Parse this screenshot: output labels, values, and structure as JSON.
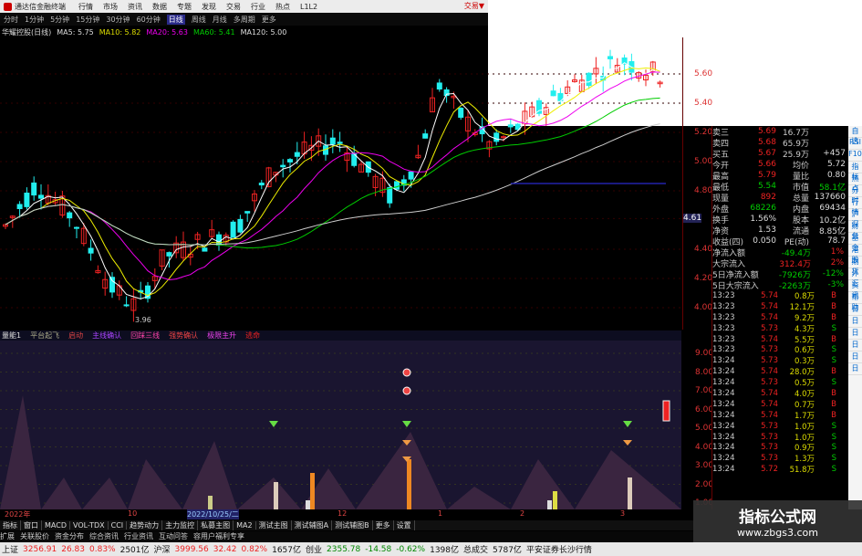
{
  "titlebar": {
    "app": "通达信金融终端",
    "trade": "交易▼"
  },
  "menu": [
    "行情",
    "市场",
    "资讯",
    "数据",
    "专题",
    "发现",
    "交易",
    "行业",
    "热点",
    "L1L2"
  ],
  "periods": [
    "分时",
    "1分钟",
    "5分钟",
    "15分钟",
    "30分钟",
    "60分钟",
    "日线",
    "周线",
    "月线",
    "多周期",
    "更多"
  ],
  "period_active": "日线",
  "ma": {
    "name": "华耀控股(日线)",
    "ma5": "MA5: 5.75",
    "ma10": "MA10: 5.82",
    "ma20": "MA20: 5.63",
    "ma60": "MA60: 5.41",
    "ma120": "MA120: 5.00"
  },
  "price_axis": [
    "5.60",
    "5.40",
    "5.20",
    "5.00",
    "4.80",
    "4.61",
    "4.40",
    "4.20",
    "4.00"
  ],
  "low_label": "3.96",
  "sub_indicator": {
    "name": "量能1",
    "items": [
      "平台起飞",
      "启动",
      "主线确认",
      "回踩三线",
      "强势确认",
      "极限主升",
      "逃命"
    ]
  },
  "sub_axis": [
    "9.00",
    "8.00",
    "7.00",
    "6.00",
    "5.00",
    "4.00",
    "3.00",
    "2.00",
    "1.00"
  ],
  "dates": [
    "2022年",
    "10",
    "2022/10/25/二",
    "12",
    "1",
    "2",
    "3"
  ],
  "tabs": [
    "指标",
    "窗口",
    "MACD",
    "VOL-TDX",
    "CCI",
    "趋势动力",
    "主力监控",
    "私募主图",
    "MA2",
    "测试主图",
    "测试辅图A",
    "测试辅图B",
    "更多",
    "设置"
  ],
  "toolbar2": [
    "扩展",
    "关联股价",
    "资金分布",
    "综合资讯",
    "行业资讯",
    "互动问答",
    "容用户福利专享"
  ],
  "status": {
    "sh_name": "上证",
    "sh": "3256.91",
    "sh_chg": "26.83",
    "sh_pct": "0.83%",
    "sh_amt": "2501亿",
    "sz_name": "沪深",
    "sz": "3999.56",
    "sz_chg": "32.42",
    "sz_pct": "0.82%",
    "sz_amt": "1657亿",
    "cy_name": "创业",
    "cy": "2355.78",
    "cy_chg": "-14.58",
    "cy_pct": "-0.62%",
    "cy_amt": "1398亿",
    "total_label": "总成交",
    "total": "5787亿",
    "broker": "平安证券长沙行情"
  },
  "quote_rows": [
    {
      "l": "卖三",
      "v": "5.69",
      "l2": "16.7万",
      "v2": ""
    },
    {
      "l": "卖四",
      "v": "5.68",
      "l2": "65.9万",
      "v2": ""
    },
    {
      "l": "买五",
      "v": "5.67",
      "l2": "25.9万",
      "v2": "+457"
    },
    {
      "l": "今开",
      "v": "5.66",
      "l2": "均价",
      "v2": "5.72"
    },
    {
      "l": "最高",
      "v": "5.79",
      "l2": "量比",
      "v2": "0.80"
    },
    {
      "l": "最低",
      "v": "5.54",
      "l2": "市值",
      "v2": "58.1亿"
    },
    {
      "l": "现量",
      "v": "892",
      "l2": "总量",
      "v2": "137660"
    },
    {
      "l": "外盘",
      "v": "68226",
      "l2": "内盘",
      "v2": "69434"
    },
    {
      "l": "换手",
      "v": "1.56%",
      "l2": "股本",
      "v2": "10.2亿"
    },
    {
      "l": "净资",
      "v": "1.53",
      "l2": "流通",
      "v2": "8.85亿"
    },
    {
      "l": "收益(四)",
      "v": "0.050",
      "l2": "PE(动)",
      "v2": "78.7"
    }
  ],
  "flow_rows": [
    {
      "l": "净流入额",
      "v": "-49.4万",
      "p": "1%"
    },
    {
      "l": "大宗流入",
      "v": "312.4万",
      "p": "2%"
    },
    {
      "l": "5日净流入额",
      "v": "-7926万",
      "p": "-12%"
    },
    {
      "l": "5日大宗流入",
      "v": "-2263万",
      "p": "-3%"
    }
  ],
  "trades": [
    {
      "t": "13:23",
      "p": "5.74",
      "v": "0.8万",
      "d": "B"
    },
    {
      "t": "13:23",
      "p": "5.74",
      "v": "12.1万",
      "d": "B"
    },
    {
      "t": "13:23",
      "p": "5.74",
      "v": "9.2万",
      "d": "B"
    },
    {
      "t": "13:23",
      "p": "5.73",
      "v": "4.3万",
      "d": "S"
    },
    {
      "t": "13:23",
      "p": "5.74",
      "v": "5.5万",
      "d": "B"
    },
    {
      "t": "13:23",
      "p": "5.73",
      "v": "0.6万",
      "d": "S"
    },
    {
      "t": "13:24",
      "p": "5.73",
      "v": "0.3万",
      "d": "S"
    },
    {
      "t": "13:24",
      "p": "5.74",
      "v": "28.0万",
      "d": "B"
    },
    {
      "t": "13:24",
      "p": "5.73",
      "v": "0.5万",
      "d": "S"
    },
    {
      "t": "13:24",
      "p": "5.74",
      "v": "4.0万",
      "d": "B"
    },
    {
      "t": "13:24",
      "p": "5.74",
      "v": "0.7万",
      "d": "B"
    },
    {
      "t": "13:24",
      "p": "5.74",
      "v": "1.7万",
      "d": "B"
    },
    {
      "t": "13:24",
      "p": "5.73",
      "v": "1.0万",
      "d": "S"
    },
    {
      "t": "13:24",
      "p": "5.73",
      "v": "1.0万",
      "d": "S"
    },
    {
      "t": "13:24",
      "p": "5.73",
      "v": "0.9万",
      "d": "S"
    },
    {
      "t": "13:24",
      "p": "5.73",
      "v": "1.3万",
      "d": "S"
    },
    {
      "t": "13:24",
      "p": "5.72",
      "v": "51.8万",
      "d": "S"
    }
  ],
  "sidebar": [
    "自选",
    "RSI",
    "F10",
    "指标",
    "热点",
    "分时",
    "行情",
    "沪深",
    "财务",
    "基金",
    "港股",
    "期货",
    "外汇",
    "资讯",
    "帮助",
    "日",
    "日",
    "日",
    "日",
    "日",
    "日"
  ],
  "watermark": {
    "w1": "指标公式网",
    "w2": "www.zbgs3.com"
  },
  "colors": {
    "up": "#e22",
    "down": "#2ee",
    "ma5": "#fff",
    "ma10": "#ee0",
    "ma20": "#e0e",
    "ma60": "#0c0",
    "ma120": "#ccc"
  }
}
